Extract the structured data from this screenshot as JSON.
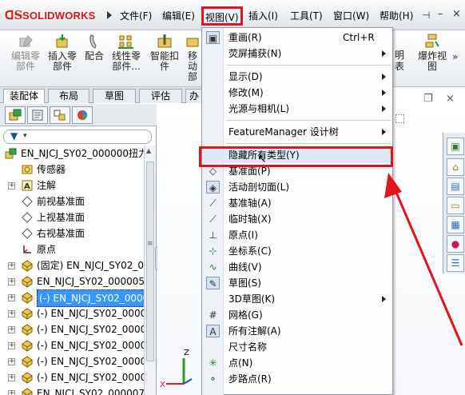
{
  "app": {
    "logo_ds": "ꓷS",
    "logo_name": "SOLIDWORKS"
  },
  "menubar": {
    "items": [
      "文件(F)",
      "编辑(E)",
      "视图(V)",
      "插入(I)",
      "工具(T)",
      "窗口(W)",
      "帮助(H)"
    ]
  },
  "toolbar": {
    "edit_part": "编辑零\n部件",
    "insert_part": "插入零\n部件",
    "mate": "配合",
    "linear_pattern": "线性零\n部件...",
    "smart_fastener": "智能扣\n件",
    "move": "移动\n部",
    "right_partial": "明\n表",
    "explode": "爆炸视\n图"
  },
  "command_tabs": [
    "装配体",
    "布局",
    "草图",
    "评估",
    "办"
  ],
  "tree": {
    "rows": [
      {
        "label": "EN_NJCJ_SY02_000000扭力",
        "level": 0,
        "icon": "assembly-icon",
        "expandable": false
      },
      {
        "label": "传感器",
        "level": 1,
        "icon": "sensor-icon",
        "expandable": false
      },
      {
        "label": "注解",
        "level": 1,
        "icon": "annotation-icon",
        "expandable": true
      },
      {
        "label": "前视基准面",
        "level": 1,
        "icon": "plane-icon",
        "expandable": false
      },
      {
        "label": "上视基准面",
        "level": 1,
        "icon": "plane-icon",
        "expandable": false
      },
      {
        "label": "右视基准面",
        "level": 1,
        "icon": "plane-icon",
        "expandable": false
      },
      {
        "label": "原点",
        "level": 1,
        "icon": "origin-icon",
        "expandable": false
      },
      {
        "label": "(固定) EN_NJCJ_SY02_0",
        "level": 1,
        "icon": "part-icon",
        "expandable": true
      },
      {
        "label": "EN_NJCJ_SY02_000005",
        "level": 1,
        "icon": "part-icon",
        "expandable": true
      },
      {
        "label": "(-) EN_NJCJ_SY02_0000",
        "level": 1,
        "icon": "part-icon",
        "expandable": true,
        "selected": true
      },
      {
        "label": "(-) EN_NJCJ_SY02_0000",
        "level": 1,
        "icon": "part-icon",
        "expandable": true
      },
      {
        "label": "(-) EN_NJCJ_SY02_0000",
        "level": 1,
        "icon": "part-icon",
        "expandable": true
      },
      {
        "label": "(-) EN_NJCJ_SY02_0000",
        "level": 1,
        "icon": "part-icon",
        "expandable": true
      },
      {
        "label": "(-) EN_NJCJ_SY02_0000",
        "level": 1,
        "icon": "part-icon",
        "expandable": true
      },
      {
        "label": "(-) EN_NJCJ_SY02_0000",
        "level": 1,
        "icon": "part-icon",
        "expandable": true
      },
      {
        "label": "EN_NJCJ_SY02_000007",
        "level": 1,
        "icon": "part-icon",
        "expandable": true
      }
    ]
  },
  "view_menu": {
    "items": [
      {
        "label": "重画(R)",
        "shortcut": "Ctrl+R",
        "icon": "redraw-icon",
        "submenu": false
      },
      {
        "label": "荧屏捕获(N)",
        "icon": "",
        "submenu": true
      },
      {
        "sep": true
      },
      {
        "label": "显示(D)",
        "icon": "",
        "submenu": true
      },
      {
        "label": "修改(M)",
        "icon": "",
        "submenu": true
      },
      {
        "label": "光源与相机(L)",
        "icon": "",
        "submenu": true
      },
      {
        "sep": true
      },
      {
        "label": "FeatureManager 设计树",
        "icon": "",
        "submenu": true
      },
      {
        "sep": true
      },
      {
        "label": "隐藏所有类型(Y)",
        "icon": "",
        "submenu": false,
        "highlighted": true
      },
      {
        "label": "基准面(P)",
        "icon": "plane-icon",
        "submenu": false
      },
      {
        "label": "活动剖切面(L)",
        "icon": "section-plane-icon",
        "submenu": false
      },
      {
        "label": "基准轴(A)",
        "icon": "axis-icon",
        "submenu": false
      },
      {
        "label": "临时轴(X)",
        "icon": "temp-axis-icon",
        "submenu": false
      },
      {
        "label": "原点(I)",
        "icon": "origin-icon",
        "submenu": false
      },
      {
        "label": "坐标系(C)",
        "icon": "coordinate-system-icon",
        "submenu": false
      },
      {
        "label": "曲线(V)",
        "icon": "curve-icon",
        "submenu": false
      },
      {
        "label": "草图(S)",
        "icon": "sketch-icon",
        "submenu": false
      },
      {
        "label": "3D草图(K)",
        "icon": "",
        "submenu": true
      },
      {
        "label": "网格(G)",
        "icon": "grid-icon",
        "submenu": false
      },
      {
        "label": "所有注解(A)",
        "icon": "all-annotations-icon",
        "submenu": false
      },
      {
        "label": "尺寸名称",
        "icon": "",
        "submenu": false
      },
      {
        "label": "点(N)",
        "icon": "point-icon",
        "submenu": false
      },
      {
        "label": "步路点(R)",
        "icon": "route-point-icon",
        "submenu": false
      }
    ]
  },
  "triad": {
    "z": "Z",
    "x": "X"
  },
  "colors": {
    "highlight_red": "#e0141b",
    "brand_red": "#d21b1b",
    "selection_blue": "#3399ff"
  }
}
